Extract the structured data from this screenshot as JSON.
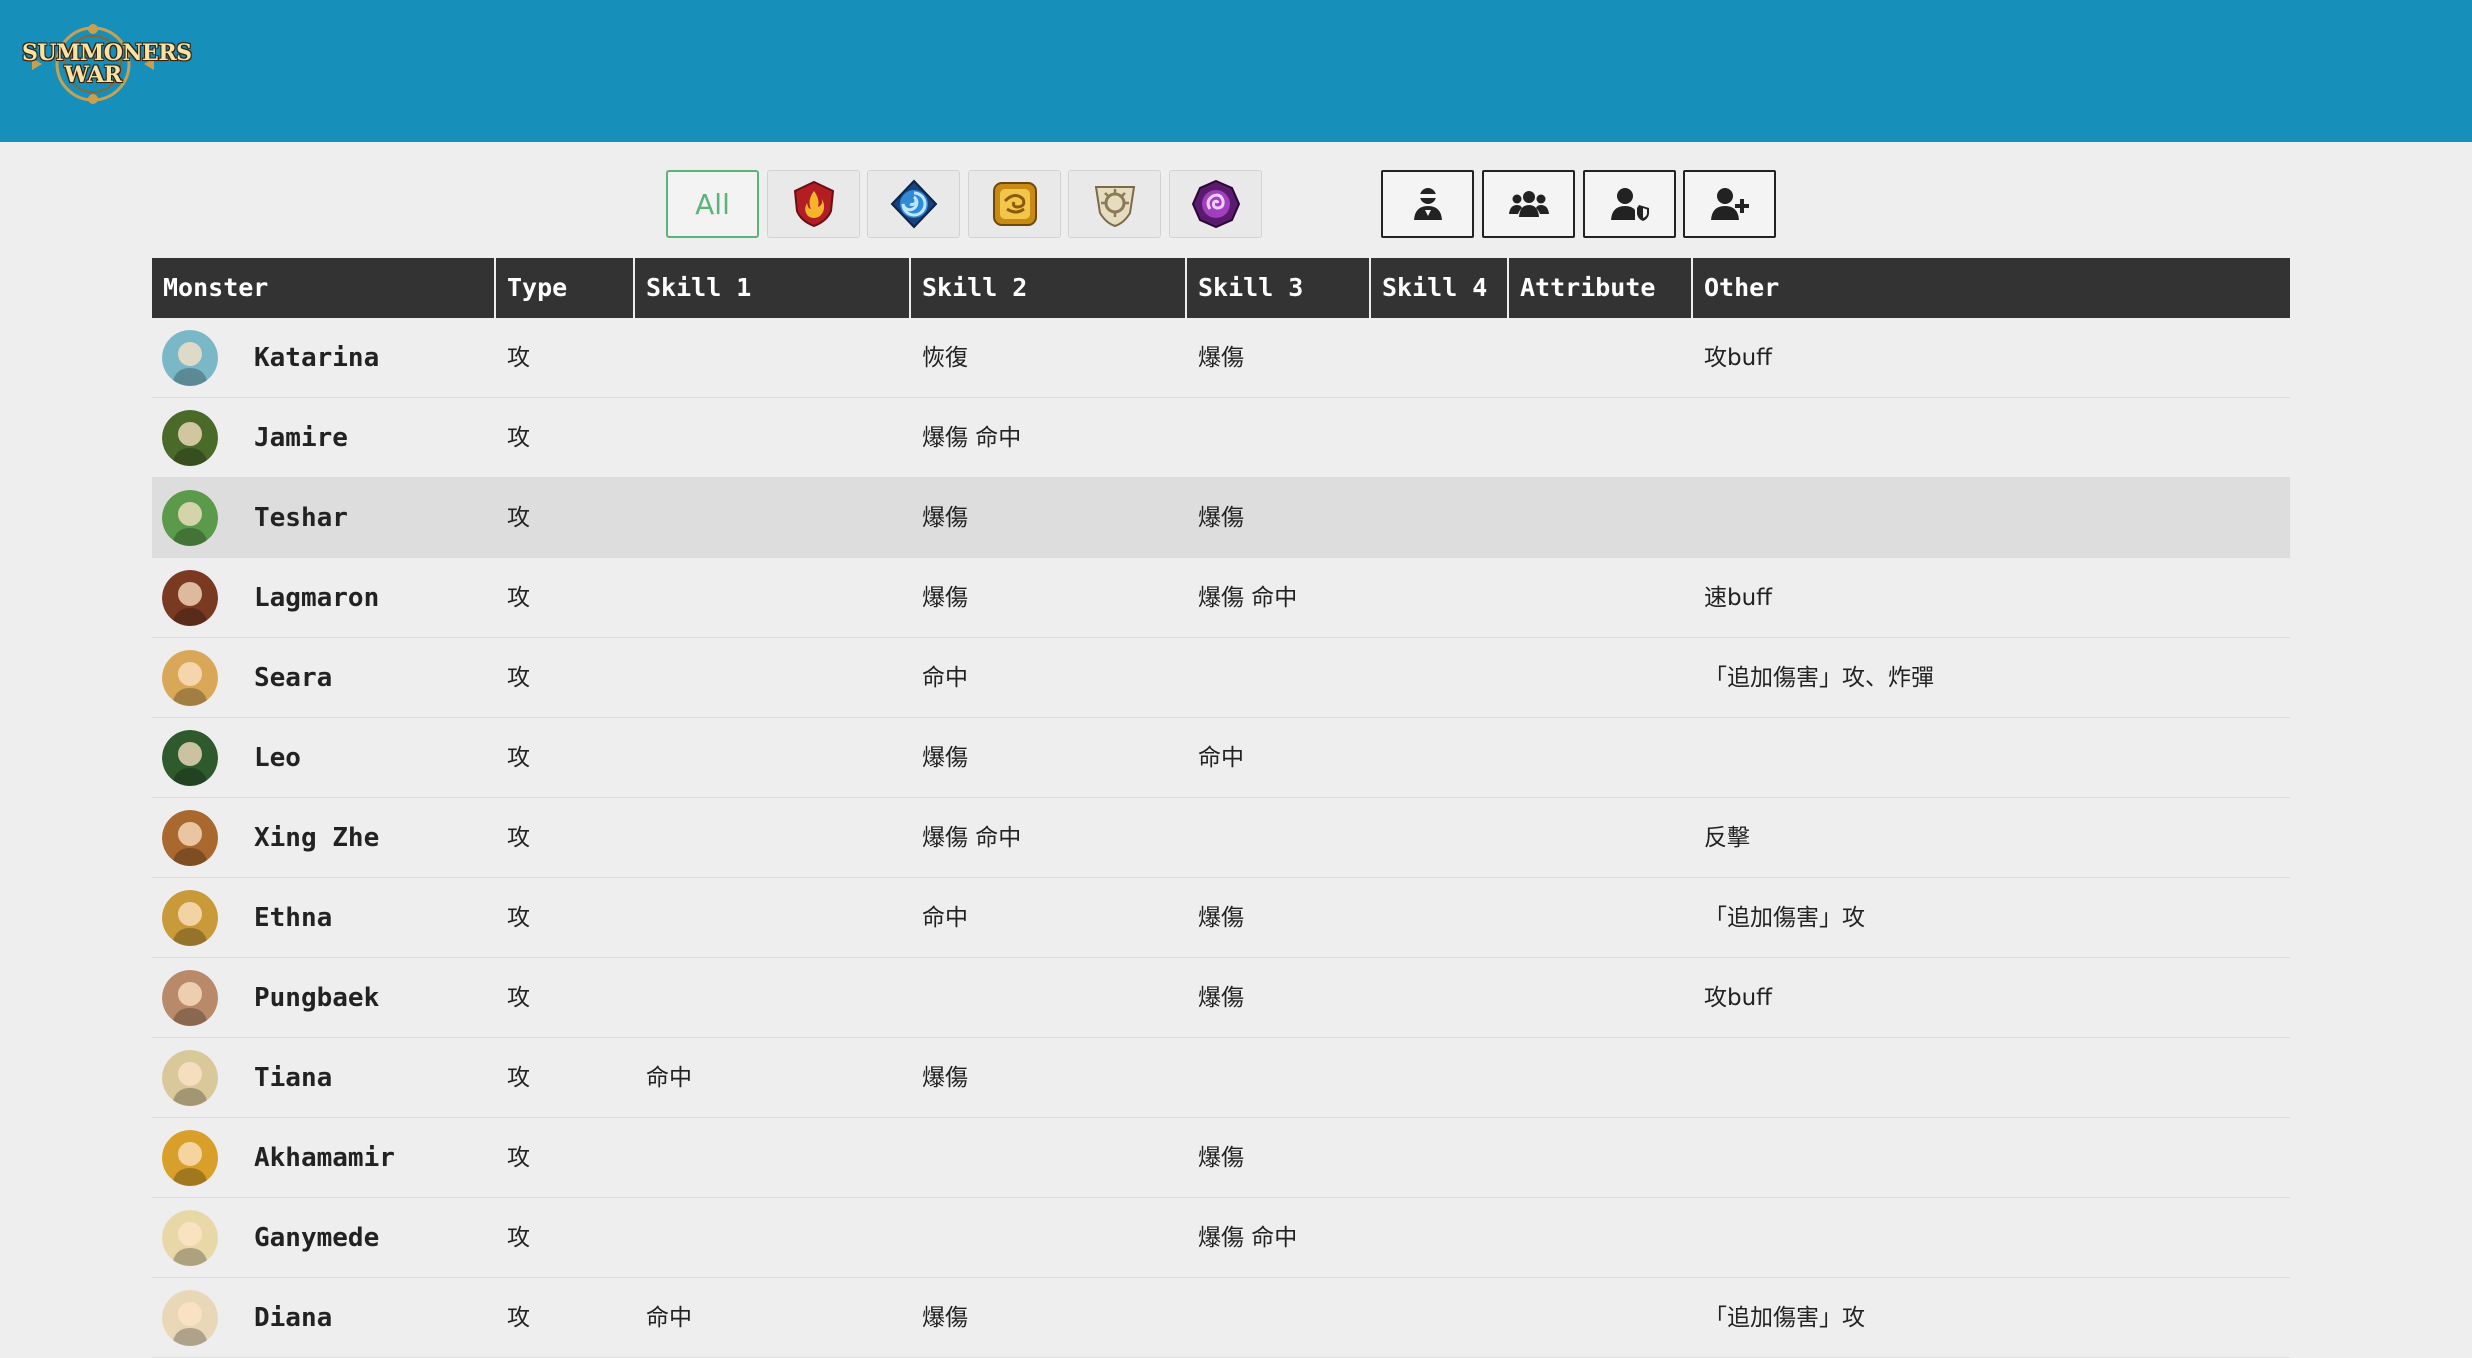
{
  "header": {
    "logo_line1": "SUMMONERS",
    "logo_line2": "WAR"
  },
  "filters": {
    "all_label": "All",
    "elements": [
      {
        "name": "fire",
        "color": "#c8242c"
      },
      {
        "name": "water",
        "color": "#1f5fb0"
      },
      {
        "name": "wind",
        "color": "#d49a1c"
      },
      {
        "name": "light",
        "color": "#cfc3a0"
      },
      {
        "name": "dark",
        "color": "#7a2a8c"
      }
    ],
    "roles": [
      {
        "icon": "single-user-ninja-icon"
      },
      {
        "icon": "user-group-icon"
      },
      {
        "icon": "user-shield-icon"
      },
      {
        "icon": "user-plus-icon"
      }
    ]
  },
  "table": {
    "columns": [
      "Monster",
      "Type",
      "Skill 1",
      "Skill 2",
      "Skill 3",
      "Skill 4",
      "Attribute",
      "Other"
    ],
    "rows": [
      {
        "monster": "Katarina",
        "avatar_color": "#7ab8c8",
        "type": "攻",
        "s1": "",
        "s2": "恢復",
        "s3": "爆傷",
        "s4": "",
        "attr": "",
        "other": "攻buff"
      },
      {
        "monster": "Jamire",
        "avatar_color": "#4a6a2a",
        "type": "攻",
        "s1": "",
        "s2": "爆傷 命中",
        "s3": "",
        "s4": "",
        "attr": "",
        "other": ""
      },
      {
        "monster": "Teshar",
        "avatar_color": "#5a9a4a",
        "type": "攻",
        "s1": "",
        "s2": "爆傷",
        "s3": "爆傷",
        "s4": "",
        "attr": "",
        "other": "",
        "highlight": true
      },
      {
        "monster": "Lagmaron",
        "avatar_color": "#7a3a22",
        "type": "攻",
        "s1": "",
        "s2": "爆傷",
        "s3": "爆傷 命中",
        "s4": "",
        "attr": "",
        "other": "速buff"
      },
      {
        "monster": "Seara",
        "avatar_color": "#d8a858",
        "type": "攻",
        "s1": "",
        "s2": "命中",
        "s3": "",
        "s4": "",
        "attr": "",
        "other": "「追加傷害」攻、炸彈"
      },
      {
        "monster": "Leo",
        "avatar_color": "#2e5a2e",
        "type": "攻",
        "s1": "",
        "s2": "爆傷",
        "s3": "命中",
        "s4": "",
        "attr": "",
        "other": ""
      },
      {
        "monster": "Xing Zhe",
        "avatar_color": "#a8682e",
        "type": "攻",
        "s1": "",
        "s2": "爆傷 命中",
        "s3": "",
        "s4": "",
        "attr": "",
        "other": "反擊"
      },
      {
        "monster": "Ethna",
        "avatar_color": "#c89a3a",
        "type": "攻",
        "s1": "",
        "s2": "命中",
        "s3": "爆傷",
        "s4": "",
        "attr": "",
        "other": "「追加傷害」攻"
      },
      {
        "monster": "Pungbaek",
        "avatar_color": "#b88a6a",
        "type": "攻",
        "s1": "",
        "s2": "",
        "s3": "爆傷",
        "s4": "",
        "attr": "",
        "other": "攻buff"
      },
      {
        "monster": "Tiana",
        "avatar_color": "#d8c89a",
        "type": "攻",
        "s1": "命中",
        "s2": "爆傷",
        "s3": "",
        "s4": "",
        "attr": "",
        "other": ""
      },
      {
        "monster": "Akhamamir",
        "avatar_color": "#d8a02a",
        "type": "攻",
        "s1": "",
        "s2": "",
        "s3": "爆傷",
        "s4": "",
        "attr": "",
        "other": ""
      },
      {
        "monster": "Ganymede",
        "avatar_color": "#e8d8a8",
        "type": "攻",
        "s1": "",
        "s2": "",
        "s3": "爆傷 命中",
        "s4": "",
        "attr": "",
        "other": ""
      },
      {
        "monster": "Diana",
        "avatar_color": "#e8d8b8",
        "type": "攻",
        "s1": "命中",
        "s2": "爆傷",
        "s3": "",
        "s4": "",
        "attr": "",
        "other": "「追加傷害」攻"
      }
    ]
  }
}
